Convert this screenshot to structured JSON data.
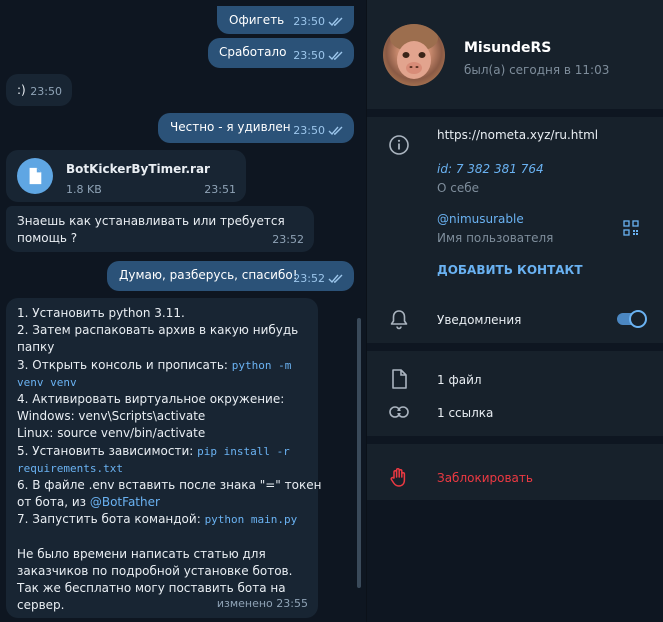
{
  "chat": {
    "messages": [
      {
        "text": "Офигеть",
        "time": "23:50"
      },
      {
        "text": "Сработало",
        "time": "23:50"
      },
      {
        "text": ":)",
        "time": "23:50"
      },
      {
        "text": "Честно - я удивлен",
        "time": "23:50"
      },
      {
        "file_name": "BotKickerByTimer.rar",
        "file_size": "1.8 KB",
        "time": "23:51"
      },
      {
        "line1": "Знаешь как устанавливать или требуется",
        "line2": "помощь ?",
        "time": "23:52"
      },
      {
        "text": "Думаю, разберусь, спасибо!",
        "time": "23:52"
      }
    ],
    "instructions": {
      "l1": "1. Установить python 3.11.",
      "l2": "2. Затем распаковать архив в какую нибудь",
      "l3": "папку",
      "l4": "3. Открыть консоль и прописать: ",
      "l4code": "python -m",
      "l5code": "venv venv",
      "l6": "4. Активировать виртуальное окружение:",
      "l7": "Windows: venv\\Scripts\\activate",
      "l8": "Linux: source venv/bin/activate",
      "l9": "5. Установить зависимости: ",
      "l9code": "pip install -r",
      "l10code": "requirements.txt",
      "l11": "6. В файле .env вставить после знака \"=\" токен",
      "l12": "от бота, из ",
      "l12link": "@BotFather",
      "l13": "7. Запустить бота командой: ",
      "l13code": "python main.py",
      "l14": "Не было времени написать статью для",
      "l15": "заказчиков по подробной установке ботов.",
      "l16": "Так же бесплатно могу поставить бота на",
      "l17": "сервер.",
      "meta": "изменено 23:55"
    }
  },
  "profile": {
    "name": "MisundeRS",
    "status": "был(а) сегодня в 11:03",
    "bio_link": "https://nometa.xyz/ru.html",
    "id_label": "id:",
    "id_value": "7 382 381 764",
    "about_label": "О себе",
    "username": "@nimusurable",
    "username_label": "Имя пользователя",
    "add_contact": "ДОБАВИТЬ КОНТАКТ",
    "notifications": "Уведомления",
    "files": "1 файл",
    "links": "1 ссылка",
    "block": "Заблокировать"
  },
  "colors": {
    "accent": "#6ab2f2",
    "danger": "#ec3942",
    "outgoing_bubble": "#2b5278",
    "incoming_bubble": "#182533"
  },
  "icons": [
    "check-ticks-icon",
    "file-icon",
    "info-icon",
    "qr-code-icon",
    "bell-icon",
    "files-icon",
    "link-icon",
    "block-hand-icon"
  ]
}
